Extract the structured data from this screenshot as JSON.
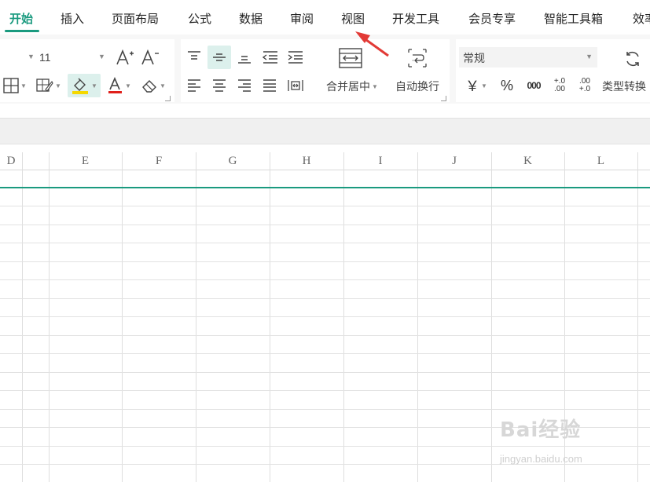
{
  "tabs": [
    {
      "label": "开始",
      "active": true
    },
    {
      "label": "插入"
    },
    {
      "label": "页面布局"
    },
    {
      "label": "公式"
    },
    {
      "label": "数据"
    },
    {
      "label": "审阅"
    },
    {
      "label": "视图"
    },
    {
      "label": "开发工具"
    },
    {
      "label": "会员专享"
    },
    {
      "label": "智能工具箱"
    },
    {
      "label": "效率"
    }
  ],
  "ribbon": {
    "font_size": "11",
    "merge_label": "合并居中",
    "wrap_label": "自动换行",
    "number_format": "常规",
    "type_convert_label": "类型转换",
    "currency_symbol": "￥",
    "percent_symbol": "%",
    "thousands_symbol": "000",
    "inc_decimal_symbol": "+.0 .00",
    "dec_decimal_symbol": ".00 +.0"
  },
  "sheet": {
    "columns": [
      "D",
      "E",
      "F",
      "G",
      "H",
      "I",
      "J",
      "K",
      "L"
    ]
  },
  "colors": {
    "accent": "#1a9a7f",
    "arrow": "#e23a36",
    "fill_highlight": "#f5d800",
    "font_color_bar": "#e0201b"
  },
  "watermark": {
    "text": "Bai经验",
    "url": "jingyan.baidu.com"
  }
}
